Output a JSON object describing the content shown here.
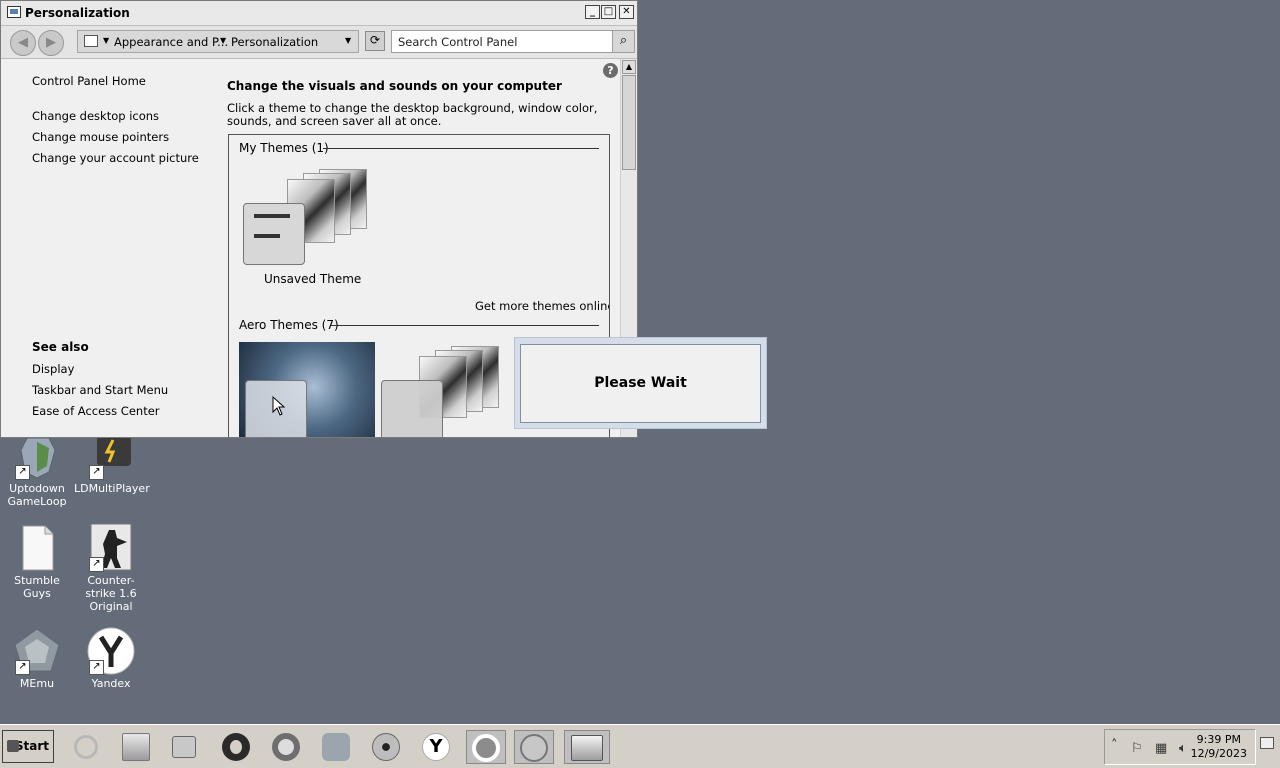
{
  "window": {
    "title": "Personalization",
    "controls": {
      "minimize": "_",
      "maximize": "□",
      "close": "✕"
    }
  },
  "navbar": {
    "back_icon": "back-arrow-icon",
    "forward_icon": "forward-arrow-icon",
    "breadcrumb": [
      "Appearance and P...",
      "Personalization"
    ],
    "search_placeholder": "Search Control Panel"
  },
  "left_panel": {
    "home": "Control Panel Home",
    "links": [
      "Change desktop icons",
      "Change mouse pointers",
      "Change your account picture"
    ],
    "see_also_title": "See also",
    "see_also": [
      "Display",
      "Taskbar and Start Menu",
      "Ease of Access Center"
    ]
  },
  "main": {
    "heading": "Change the visuals and sounds on your computer",
    "description": "Click a theme to change the desktop background, window color, sounds, and screen saver all at once.",
    "my_themes": {
      "title": "My Themes (1)",
      "items": [
        {
          "name": "Unsaved Theme"
        }
      ],
      "more_link": "Get more themes online"
    },
    "aero_themes": {
      "title": "Aero Themes (7)"
    }
  },
  "dialog": {
    "message": "Please Wait"
  },
  "desktop_icons": [
    {
      "label": "Uptodown GameLoop",
      "icon": "gameloop-shield-icon"
    },
    {
      "label": "LDMultiPlayer",
      "icon": "ldmultiplayer-icon"
    },
    {
      "label": "Stumble Guys",
      "icon": "blank-file-icon"
    },
    {
      "label": "Counter-strike 1.6 Original",
      "icon": "counter-strike-icon"
    },
    {
      "label": "MEmu",
      "icon": "memu-icon"
    },
    {
      "label": "Yandex",
      "icon": "yandex-icon"
    }
  ],
  "taskbar": {
    "start_label": "Start",
    "icons": [
      "internet-explorer-icon",
      "file-explorer-icon",
      "media-player-icon",
      "opera-icon",
      "chrome-icon",
      "security-shield-icon",
      "keyhole-icon",
      "yandex-icon",
      "gameloop-icon",
      "ld-icon",
      "control-panel-icon"
    ],
    "time": "9:39 PM",
    "date": "12/9/2023"
  },
  "colors": {
    "desktop": "#636c78",
    "window_bg": "#f0f0f0",
    "taskbar": "#d4d0c8"
  }
}
